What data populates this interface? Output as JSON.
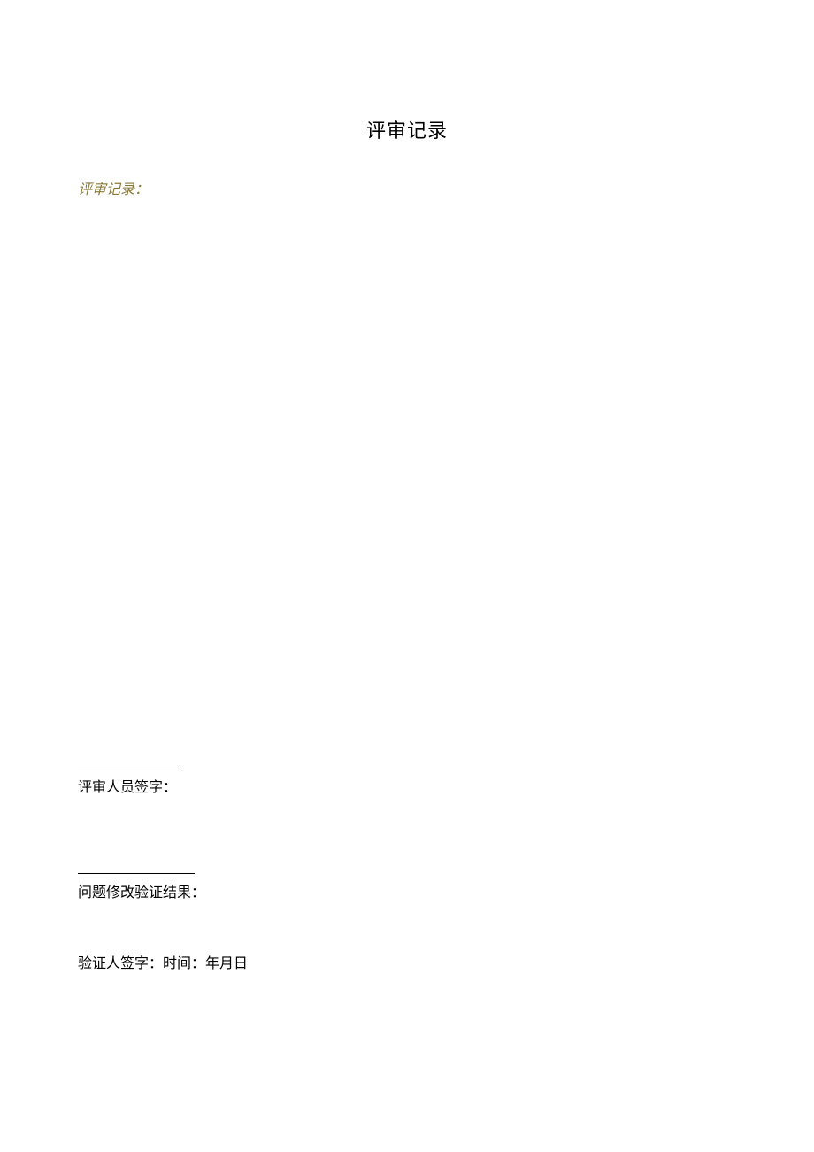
{
  "title": "评审记录",
  "review_record_label": "评审记录：",
  "reviewer_signature_label": "评审人员签字：",
  "verification_result_label": "问题修改验证结果：",
  "verifier_signature_line": "验证人签字：时间：年月日"
}
